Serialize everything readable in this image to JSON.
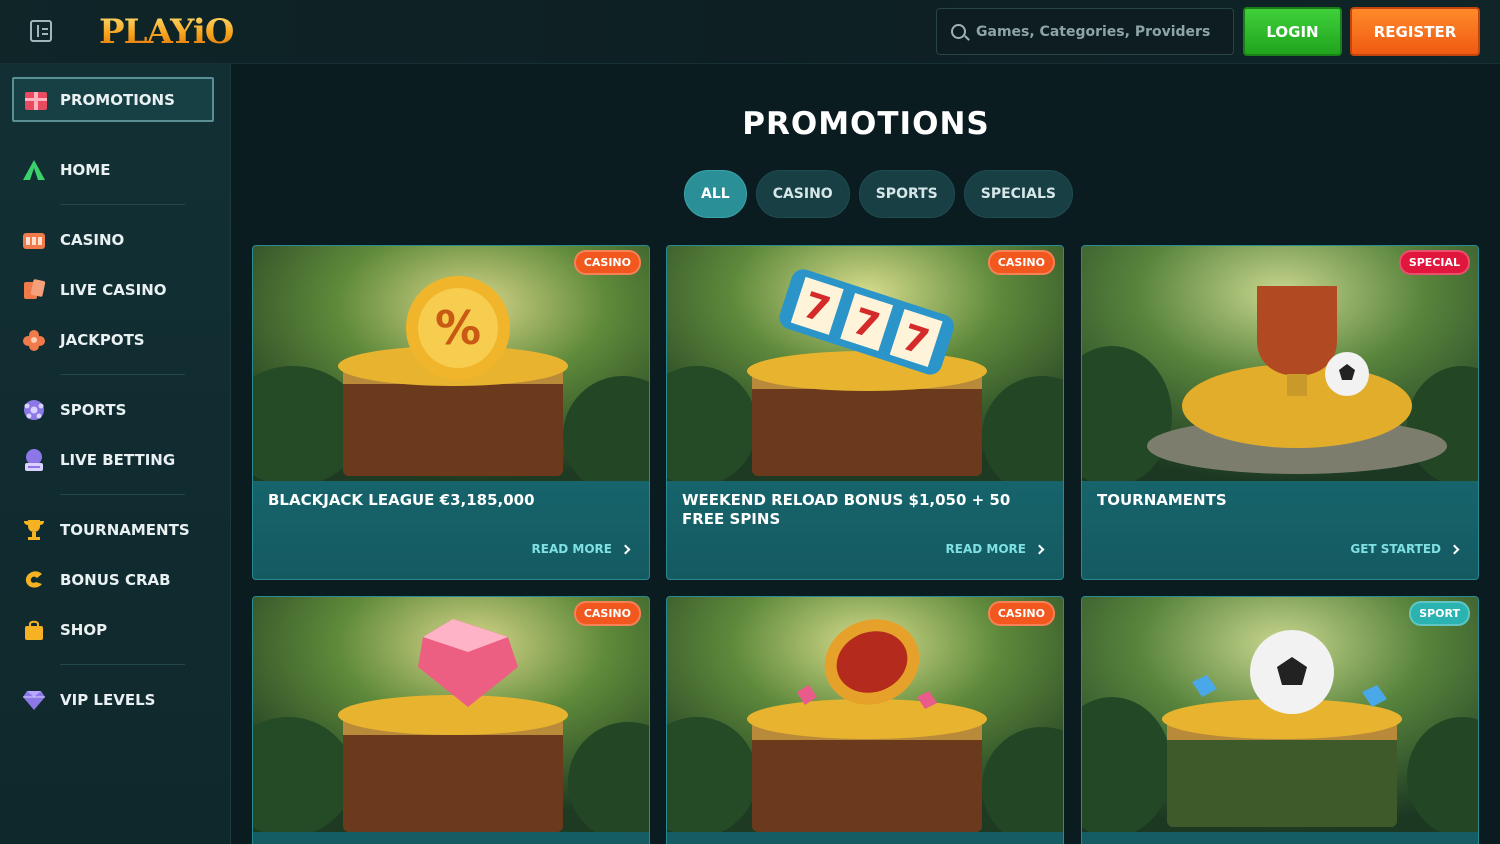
{
  "header": {
    "logo": "PLAYiO",
    "search_placeholder": "Games, Categories, Providers",
    "login_label": "LOGIN",
    "register_label": "REGISTER"
  },
  "sidebar": {
    "active": {
      "label": "PROMOTIONS",
      "icon": "promotions-icon"
    },
    "items": [
      {
        "label": "HOME",
        "icon": "home-icon"
      },
      {
        "label": "CASINO",
        "icon": "casino-icon"
      },
      {
        "label": "LIVE CASINO",
        "icon": "live-casino-icon"
      },
      {
        "label": "JACKPOTS",
        "icon": "jackpots-icon"
      },
      {
        "label": "SPORTS",
        "icon": "sports-icon"
      },
      {
        "label": "LIVE BETTING",
        "icon": "live-betting-icon"
      },
      {
        "label": "TOURNAMENTS",
        "icon": "trophy-icon"
      },
      {
        "label": "BONUS CRAB",
        "icon": "bonus-crab-icon"
      },
      {
        "label": "SHOP",
        "icon": "shop-bag-icon"
      },
      {
        "label": "VIP LEVELS",
        "icon": "diamond-icon"
      }
    ]
  },
  "main": {
    "title": "PROMOTIONS",
    "filters": [
      "ALL",
      "CASINO",
      "SPORTS",
      "SPECIALS"
    ],
    "active_filter": "ALL",
    "cards": [
      {
        "badge": "CASINO",
        "title": "BLACKJACK LEAGUE €3,185,000",
        "cta": "READ MORE",
        "art": "treasure chest with percent coin"
      },
      {
        "badge": "CASINO",
        "title": "WEEKEND RELOAD BONUS $1,050 + 50 FREE SPINS",
        "cta": "READ MORE",
        "art": "treasure chest with 777 slot reel"
      },
      {
        "badge": "SPECIAL",
        "title": "TOURNAMENTS",
        "cta": "GET STARTED",
        "art": "trophy on gold coins"
      },
      {
        "badge": "CASINO",
        "title": "",
        "cta": "",
        "art": "treasure chest with pink gem"
      },
      {
        "badge": "CASINO",
        "title": "",
        "cta": "",
        "art": "treasure chest with red coin"
      },
      {
        "badge": "SPORT",
        "title": "",
        "cta": "",
        "art": "treasure chest with football"
      }
    ]
  },
  "colors": {
    "background": "#0b1c20",
    "sidebar": "#123034",
    "card": "#1e7b84",
    "login_green": "#2fbf2a",
    "register_orange": "#f76b1c",
    "badge_casino": "#f2571e",
    "badge_special": "#e0163c",
    "badge_sport": "#2ab3b0"
  }
}
